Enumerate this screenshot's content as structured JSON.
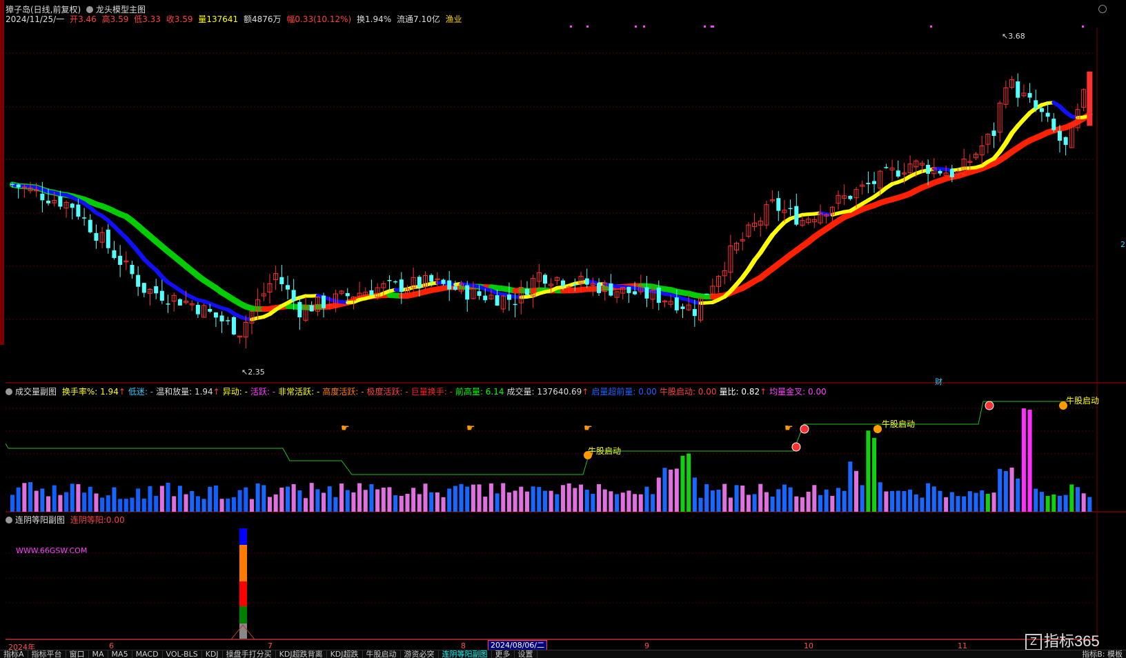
{
  "title_bar": {
    "stock": "獐子岛(日线,前复权)",
    "indicator": "龙头模型主图"
  },
  "quote_line": {
    "date": "2024/11/25/一",
    "open_label": "开",
    "open": "3.46",
    "high_label": "高",
    "high": "3.59",
    "low_label": "低",
    "low": "3.33",
    "close_label": "收",
    "close": "3.59",
    "vol_label": "量",
    "vol": "137641",
    "amount_label": "额",
    "amount": "4876万",
    "change_label": "幅",
    "change": "0.33(10.12%)",
    "turnover_label": "换",
    "turnover": "1.94%",
    "float_label": "流通",
    "float": "7.10亿",
    "sector": "渔业"
  },
  "main_chart": {
    "high_marker": "3.68",
    "low_marker": "2.35",
    "finance_marker": "财",
    "right_value": "2",
    "y_range": [
      2.2,
      3.8
    ]
  },
  "volume_header": {
    "name": "成交量副图",
    "items": [
      {
        "label": "换手率%:",
        "value": "1.94",
        "arrow": "↑",
        "color": "#ffff00"
      },
      {
        "label": "低迷:",
        "value": "-",
        "color": "#37c8ff"
      },
      {
        "label": "温和放量:",
        "value": "1.94",
        "arrow": "↑",
        "color": "#dddddd"
      },
      {
        "label": "异动:",
        "value": "-",
        "color": "#ffff00"
      },
      {
        "label": "活跃:",
        "value": "-",
        "color": "#ff40ff"
      },
      {
        "label": "非常活跃:",
        "value": "-",
        "color": "#ffff00"
      },
      {
        "label": "高度活跃:",
        "value": "-",
        "color": "#ff7a00"
      },
      {
        "label": "极度活跃:",
        "value": "-",
        "color": "#ff4040"
      },
      {
        "label": "巨量换手:",
        "value": "-",
        "color": "#ff2020"
      },
      {
        "label": "前高量:",
        "value": "6.14",
        "color": "#00ff00"
      },
      {
        "label": "成交量:",
        "value": "137640.69",
        "arrow": "↑",
        "color": "#dddddd"
      },
      {
        "label": "启量超前量:",
        "value": "0.00",
        "color": "#2060ff"
      },
      {
        "label": "牛股启动:",
        "value": "0.00",
        "color": "#ff4040"
      },
      {
        "label": "量比:",
        "value": "0.82",
        "arrow": "↑",
        "color": "#ffffff"
      },
      {
        "label": "均量金叉:",
        "value": "0.00",
        "color": "#ff40ff"
      }
    ],
    "annotations": [
      "牛股启动",
      "牛股启动",
      "牛股启动"
    ]
  },
  "lower_panel": {
    "name": "连阴等阳副图",
    "label": "连阴等阳:",
    "value": "0.00",
    "watermark_text": "WWW.66GSW.COM"
  },
  "x_axis": {
    "labels": [
      "2024年",
      "6",
      "7",
      "8",
      "9",
      "10",
      "11"
    ],
    "selected_date": "2024/08/06/二"
  },
  "watermark": {
    "box": "Z",
    "text": "指标365"
  },
  "bottom_tabs": [
    "指标A",
    "指标平台",
    "窗口",
    "MA",
    "MA5",
    "MACD",
    "VOL-BLS",
    "KDJ",
    "操盘手打分买",
    "KDJ超跌背离",
    "KDJ超跌",
    "牛股启动",
    "游资必突",
    "连阴等阳副图",
    "更多",
    "设置"
  ],
  "bottom_right": "指标B: 模板",
  "colors": {
    "up": "#ff3030",
    "down": "#54ffff",
    "ma_fast": "#ffff00",
    "ma_slow": "#ff2000",
    "ma_blue": "#1010ff",
    "ma_green": "#00cc00"
  }
}
